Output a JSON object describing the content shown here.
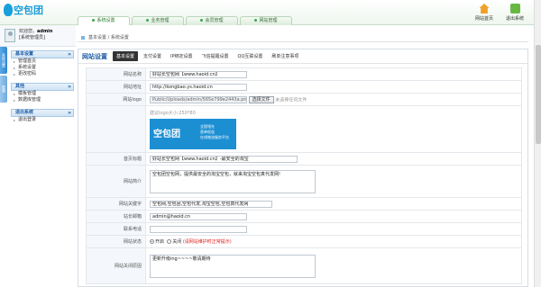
{
  "header": {
    "logo_text": "空包团",
    "tabs": [
      "系统设置",
      "业务管理",
      "会员管理",
      "网站管理"
    ],
    "home_label": "网站首页",
    "logout_label": "退出系统"
  },
  "user": {
    "welcome": "欢迎您，",
    "name": "admin",
    "role": "[系统管理员]"
  },
  "side_tabs": [
    "系统设置",
    "管理"
  ],
  "menu": [
    {
      "head": "基本设置",
      "items": [
        "管理首页",
        "系统设置",
        "更改密码"
      ]
    },
    {
      "head": "其他",
      "items": [
        "模板管理",
        "数据库管理"
      ]
    },
    {
      "head": "退出系统",
      "items": [
        "退出登录"
      ]
    }
  ],
  "breadcrumb": "基本设置 / 系统设置",
  "subnav": {
    "title": "网站设置",
    "tabs": [
      "基本设置",
      "支付设置",
      "IP绑定设置",
      "飞信提醒设置",
      "QQ互联设置",
      "刷单注意事项"
    ]
  },
  "form": {
    "site_name_label": "网站名称",
    "site_name": "好站长空包网【www.haoid.cn】",
    "site_url_label": "网站地址",
    "site_url": "http://kongbao.ys.haoid.cn",
    "logo_label": "网站logo",
    "logo_path": "Public/Uploads/admin/565e799e2443a.png",
    "choose_file": "选择文件",
    "no_file": "未选择任何文件",
    "logo_size_hint": "建议logo大小:250*80",
    "logo_preview_main": "空包团",
    "logo_preview_sub1": "全国领先",
    "logo_preview_sub2": "直单权益",
    "logo_preview_sub3": "在线物流服务平台",
    "page_title_label": "首页标题",
    "page_title": "好站长空包网【www.haoid.cn】-最安全的淘宝",
    "site_desc_label": "网站简介",
    "site_desc": "空包团空包网，提供最安全的淘宝空包，就来淘宝空包真代发网!",
    "keywords_label": "网站关键字",
    "keywords": "空包网,空包团,空包代发,淘宝空包,空包真代发网",
    "email_label": "站长邮箱",
    "email": "admin@haoid.cn",
    "phone_label": "联系电话",
    "phone": "",
    "status_label": "网站状态",
    "status_open": "开启",
    "status_close": "关闭",
    "status_hint": "(请网站维护时正常提示)",
    "close_reason_label": "网站关闭原因",
    "close_reason": "更新升级ing~~~~敬请期待"
  },
  "colors": {
    "brand_blue": "#1b9dd9",
    "nav_blue": "#1f5fa6",
    "tab_green": "#2c7a2c"
  }
}
